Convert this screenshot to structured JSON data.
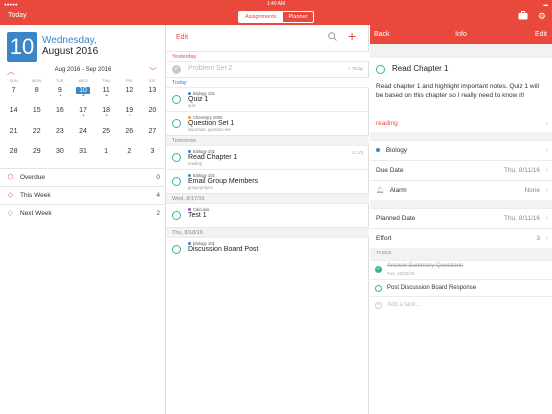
{
  "status": {
    "time": "1:40 AM",
    "signal": "●●●●● ",
    "battery": "▬"
  },
  "navbar": {
    "today_label": "Today",
    "tabs": [
      {
        "label": "Assignments",
        "active": true
      },
      {
        "label": "Planner",
        "active": false
      }
    ],
    "icons": [
      "briefcase-icon",
      "gear-icon"
    ]
  },
  "left": {
    "date_number": "10",
    "weekday": "Wednesday,",
    "date_text": "August 2016",
    "range_label": "Aug 2016 - Sep 2016",
    "dow": [
      "SUN",
      "MON",
      "TUE",
      "WED",
      "THU",
      "FRI",
      "SAT"
    ],
    "weeks": [
      [
        {
          "d": "7"
        },
        {
          "d": "8"
        },
        {
          "d": "9",
          "dots": "•"
        },
        {
          "d": "10",
          "sel": true,
          "dots": "••"
        },
        {
          "d": "11",
          "dots": "••"
        },
        {
          "d": "12"
        },
        {
          "d": "13"
        }
      ],
      [
        {
          "d": "14"
        },
        {
          "d": "15"
        },
        {
          "d": "16"
        },
        {
          "d": "17",
          "dots": "•"
        },
        {
          "d": "18",
          "dots": "•"
        },
        {
          "d": "19",
          "dots": "•",
          "dotcolor": "orange"
        },
        {
          "d": "20"
        }
      ],
      [
        {
          "d": "21"
        },
        {
          "d": "22"
        },
        {
          "d": "23"
        },
        {
          "d": "24"
        },
        {
          "d": "25"
        },
        {
          "d": "26"
        },
        {
          "d": "27"
        }
      ],
      [
        {
          "d": "28"
        },
        {
          "d": "29"
        },
        {
          "d": "30"
        },
        {
          "d": "31"
        },
        {
          "d": "1"
        },
        {
          "d": "2"
        },
        {
          "d": "3"
        }
      ]
    ],
    "summary": [
      {
        "label": "Overdue",
        "count": "0",
        "icon": "alert-icon"
      },
      {
        "label": "This Week",
        "count": "4",
        "icon": "week-icon"
      },
      {
        "label": "Next Week",
        "count": "2",
        "icon": "next-week-icon"
      }
    ]
  },
  "middle": {
    "edit_label": "Edit",
    "sections": [
      {
        "header": "Yesterday",
        "red": true,
        "tasks": [
          {
            "course": "",
            "title": "Problem Set 2",
            "tags": "",
            "done": true,
            "right": "✓ Today"
          }
        ]
      },
      {
        "header": "Today",
        "red": false,
        "tasks": [
          {
            "course": "Biology 101",
            "course_color": "#3a86c9",
            "title": "Quiz 1",
            "tags": "quiz",
            "done": false,
            "right": ""
          },
          {
            "course": "Chemistry 2000",
            "course_color": "#f0a030",
            "title": "Question Set 1",
            "tags": "important, question-set",
            "done": false,
            "right": ""
          }
        ]
      },
      {
        "header": "Tomorrow",
        "red": false,
        "tasks": [
          {
            "course": "Biology 101",
            "course_color": "#3a86c9",
            "title": "Read Chapter 1",
            "tags": "reading",
            "done": false,
            "right": "☑ 1/3"
          },
          {
            "course": "Biology 101",
            "course_color": "#3a86c9",
            "title": "Email Group Members",
            "tags": "group-project",
            "done": false,
            "right": ""
          }
        ]
      },
      {
        "header": "Wed, 8/17/16",
        "red": false,
        "tasks": [
          {
            "course": "Calculus",
            "course_color": "#9b59b6",
            "title": "Test 1",
            "tags": "",
            "done": false,
            "right": ""
          }
        ]
      },
      {
        "header": "Thu, 8/18/16",
        "red": false,
        "tasks": [
          {
            "course": "Biology 101",
            "course_color": "#3a86c9",
            "title": "Discussion Board Post",
            "tags": "",
            "done": false,
            "right": ""
          }
        ]
      }
    ]
  },
  "right": {
    "back_label": "Back",
    "title": "Info",
    "edit_label": "Edit",
    "task_title": "Read Chapter 1",
    "description": "Read chapter 1 and highlight important notes. Quiz 1 will be based on this chapter so I really need to know it!",
    "tag": "reading",
    "course": "Biology",
    "due_label": "Due Date",
    "due_value": "Thu, 8/11/16",
    "alarm_label": "Alarm",
    "alarm_value": "None",
    "planned_label": "Planned Date",
    "planned_value": "Thu, 8/11/16",
    "effort_label": "Effort",
    "effort_value": "3",
    "tasks_header": "TASKS",
    "subtasks": [
      {
        "title": "Answer Summary Questions",
        "date": "Tue, 12/22/15",
        "done": true
      },
      {
        "title": "Post Discussion Board Response",
        "date": "",
        "done": false
      }
    ],
    "add_placeholder": "Add a task..."
  }
}
